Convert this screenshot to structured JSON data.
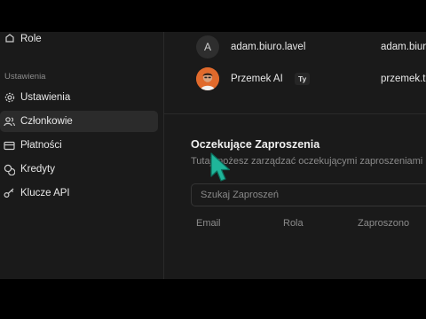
{
  "sidebar": {
    "top_item": {
      "label": "Role"
    },
    "section_label": "Ustawienia",
    "items": [
      {
        "label": "Ustawienia",
        "icon": "gear-icon",
        "active": false
      },
      {
        "label": "Członkowie",
        "icon": "users-icon",
        "active": true
      },
      {
        "label": "Płatności",
        "icon": "credit-card-icon",
        "active": false
      },
      {
        "label": "Kredyty",
        "icon": "coins-icon",
        "active": false
      },
      {
        "label": "Klucze API",
        "icon": "key-icon",
        "active": false
      }
    ]
  },
  "members": [
    {
      "avatar_letter": "A",
      "name": "adam.biuro.lavel",
      "email": "adam.biuro.",
      "is_you": false
    },
    {
      "avatar_letter": "",
      "name": "Przemek AI",
      "email": "przemek.t",
      "is_you": true
    }
  ],
  "you_badge": "Ty",
  "invitations": {
    "title": "Oczekujące Zaproszenia",
    "subtitle": "Tutaj możesz zarządzać oczekującymi zaproszeniami",
    "search_placeholder": "Szukaj Zaproszeń",
    "columns": [
      "Email",
      "Rola",
      "Zaproszono"
    ]
  },
  "colors": {
    "background": "#1a1a1a",
    "active_item": "#2b2b2b",
    "avatar_photo": "#e06a2c",
    "cursor": "#1fb59a"
  }
}
